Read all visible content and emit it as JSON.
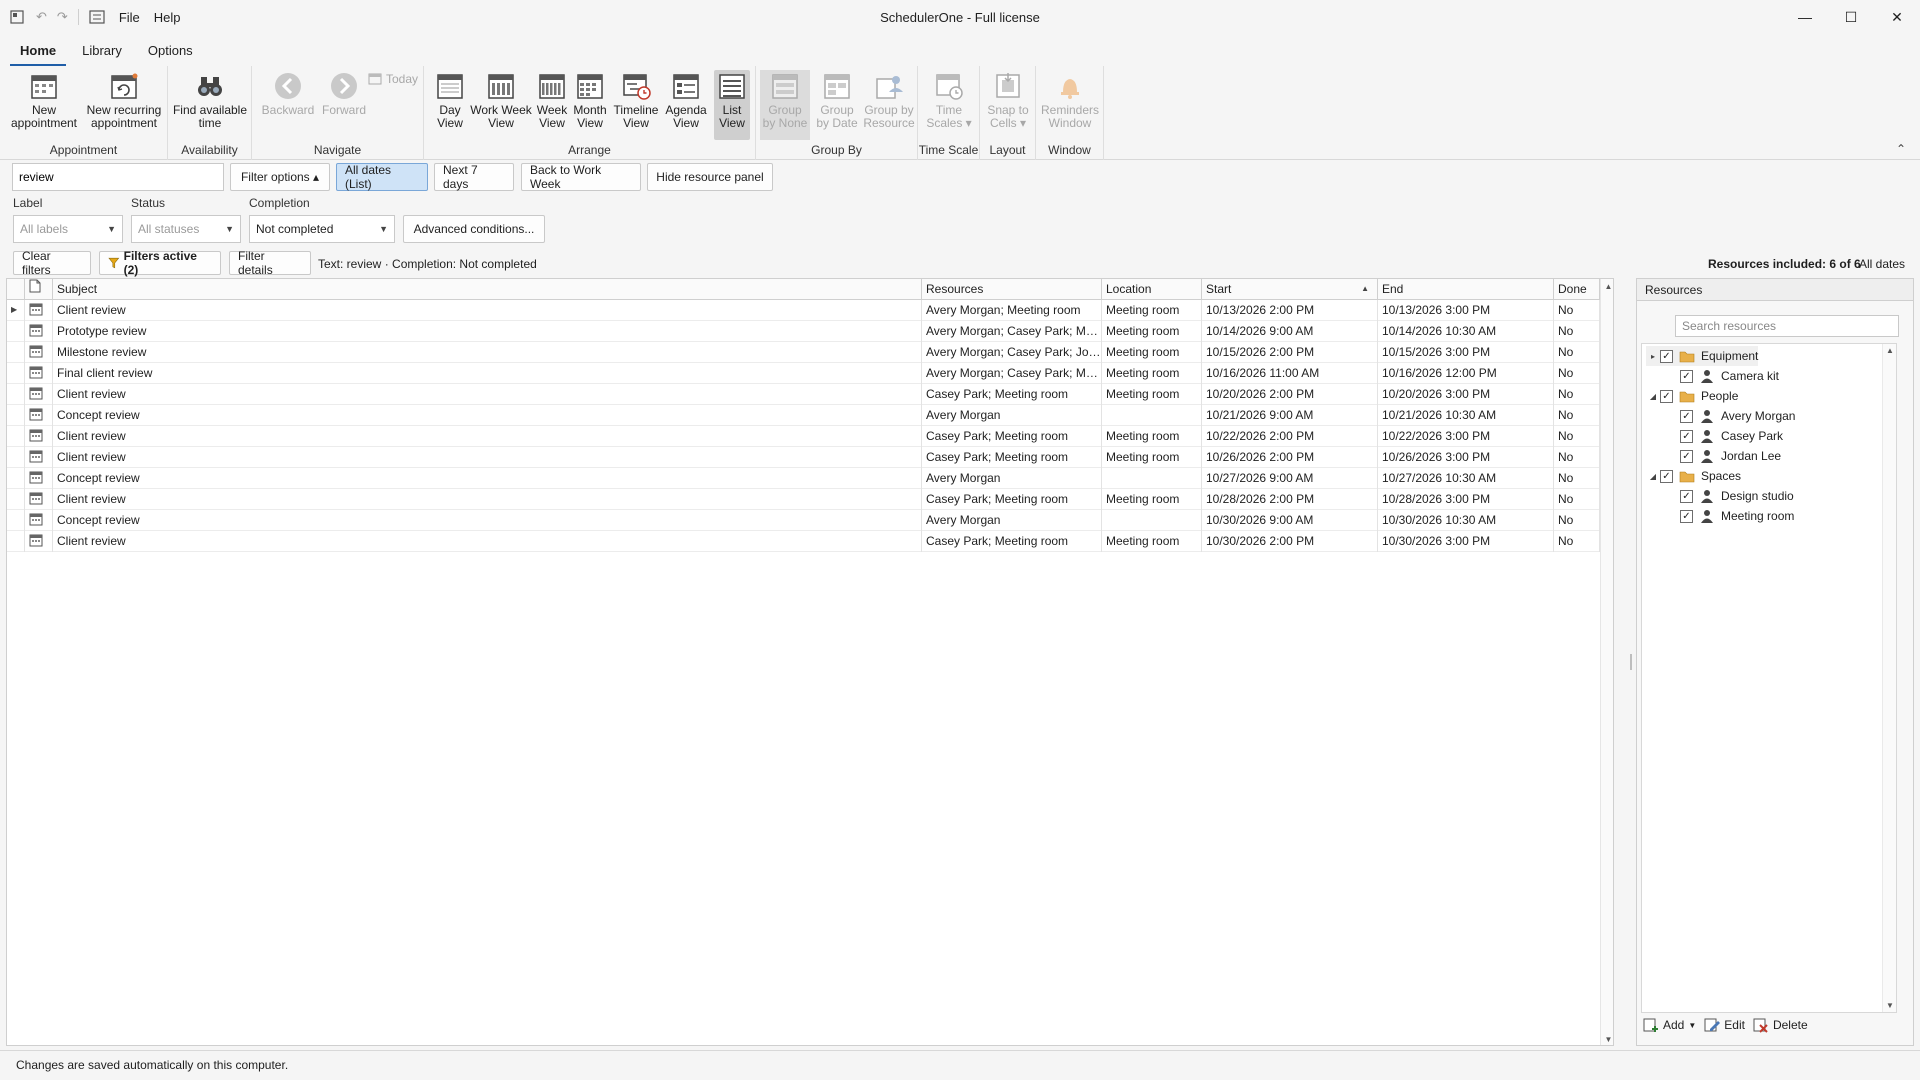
{
  "window": {
    "title": "SchedulerOne - Full license",
    "menu": [
      "File",
      "Help"
    ],
    "minimize_glyph": "—",
    "maximize_glyph": "☐",
    "close_glyph": "✕"
  },
  "tabs": [
    "Home",
    "Library",
    "Options"
  ],
  "ribbon": {
    "groups": {
      "appointment": "Appointment",
      "availability": "Availability",
      "navigate": "Navigate",
      "arrange": "Arrange",
      "group_by": "Group By",
      "time_scale": "Time Scale",
      "layout": "Layout",
      "window": "Window"
    },
    "buttons": {
      "new_appointment": [
        "New",
        "appointment"
      ],
      "new_recurring": [
        "New recurring",
        "appointment"
      ],
      "find_time": [
        "Find available",
        "time"
      ],
      "backward": "Backward",
      "forward": "Forward",
      "today": "Today",
      "day_view": [
        "Day",
        "View"
      ],
      "work_week_view": [
        "Work Week",
        "View"
      ],
      "week_view": [
        "Week",
        "View"
      ],
      "month_view": [
        "Month",
        "View"
      ],
      "timeline_view": [
        "Timeline",
        "View"
      ],
      "agenda_view": [
        "Agenda",
        "View"
      ],
      "list_view": [
        "List",
        "View"
      ],
      "group_none": [
        "Group",
        "by None"
      ],
      "group_date": [
        "Group",
        "by Date"
      ],
      "group_resource": [
        "Group by",
        "Resource"
      ],
      "time_scales": [
        "Time",
        "Scales ▾"
      ],
      "snap_cells": [
        "Snap to",
        "Cells ▾"
      ],
      "reminders": [
        "Reminders",
        "Window"
      ]
    }
  },
  "filter": {
    "search_value": "review",
    "filter_options": "Filter options ▴",
    "all_dates": "All dates (List)",
    "next_7_days": "Next 7 days",
    "back_work_week": "Back to Work Week",
    "hide_resource_panel": "Hide resource panel",
    "label_caption": "Label",
    "status_caption": "Status",
    "completion_caption": "Completion",
    "label_value": "All labels",
    "status_value": "All statuses",
    "completion_value": "Not completed",
    "advanced": "Advanced conditions...",
    "clear_filters": "Clear filters",
    "filters_active": "Filters active (2)",
    "filter_details": "Filter details",
    "summary_text": "Text: review",
    "summary_sep": "·",
    "summary_completion": "Completion: Not completed",
    "resources_included": "Resources included: 6 of 6",
    "all_dates_right": "All dates"
  },
  "grid": {
    "columns": [
      "Subject",
      "Resources",
      "Location",
      "Start",
      "End",
      "Done"
    ],
    "rows": [
      [
        "Client review",
        "Avery Morgan; Meeting room",
        "Meeting room",
        "10/13/2026 2:00 PM",
        "10/13/2026 3:00 PM",
        "No"
      ],
      [
        "Prototype review",
        "Avery Morgan; Casey Park; Me...",
        "Meeting room",
        "10/14/2026 9:00 AM",
        "10/14/2026 10:30 AM",
        "No"
      ],
      [
        "Milestone review",
        "Avery Morgan; Casey Park; Jor...",
        "Meeting room",
        "10/15/2026 2:00 PM",
        "10/15/2026 3:00 PM",
        "No"
      ],
      [
        "Final client review",
        "Avery Morgan; Casey Park; Me...",
        "Meeting room",
        "10/16/2026 11:00 AM",
        "10/16/2026 12:00 PM",
        "No"
      ],
      [
        "Client review",
        "Casey Park; Meeting room",
        "Meeting room",
        "10/20/2026 2:00 PM",
        "10/20/2026 3:00 PM",
        "No"
      ],
      [
        "Concept review",
        "Avery Morgan",
        "",
        "10/21/2026 9:00 AM",
        "10/21/2026 10:30 AM",
        "No"
      ],
      [
        "Client review",
        "Casey Park; Meeting room",
        "Meeting room",
        "10/22/2026 2:00 PM",
        "10/22/2026 3:00 PM",
        "No"
      ],
      [
        "Client review",
        "Casey Park; Meeting room",
        "Meeting room",
        "10/26/2026 2:00 PM",
        "10/26/2026 3:00 PM",
        "No"
      ],
      [
        "Concept review",
        "Avery Morgan",
        "",
        "10/27/2026 9:00 AM",
        "10/27/2026 10:30 AM",
        "No"
      ],
      [
        "Client review",
        "Casey Park; Meeting room",
        "Meeting room",
        "10/28/2026 2:00 PM",
        "10/28/2026 3:00 PM",
        "No"
      ],
      [
        "Concept review",
        "Avery Morgan",
        "",
        "10/30/2026 9:00 AM",
        "10/30/2026 10:30 AM",
        "No"
      ],
      [
        "Client review",
        "Casey Park; Meeting room",
        "Meeting room",
        "10/30/2026 2:00 PM",
        "10/30/2026 3:00 PM",
        "No"
      ]
    ]
  },
  "resources": {
    "title": "Resources",
    "search_placeholder": "Search resources",
    "tree": [
      {
        "label": "Equipment",
        "kind": "folder",
        "level": 0,
        "expander": "▸"
      },
      {
        "label": "Camera kit",
        "kind": "person",
        "level": 1
      },
      {
        "label": "People",
        "kind": "folder",
        "level": 0,
        "expander": "◢"
      },
      {
        "label": "Avery Morgan",
        "kind": "person",
        "level": 1
      },
      {
        "label": "Casey Park",
        "kind": "person",
        "level": 1
      },
      {
        "label": "Jordan Lee",
        "kind": "person",
        "level": 1
      },
      {
        "label": "Spaces",
        "kind": "folder",
        "level": 0,
        "expander": "◢"
      },
      {
        "label": "Design studio",
        "kind": "person",
        "level": 1
      },
      {
        "label": "Meeting room",
        "kind": "person",
        "level": 1
      }
    ],
    "add": "Add",
    "edit": "Edit",
    "delete": "Delete"
  },
  "status_bar": "Changes are saved automatically on this computer.",
  "colors": {
    "accent": "#1f5ea8",
    "selected_button": "#cfe3f7",
    "folder": "#e8b04a",
    "delete": "#c0392b"
  }
}
